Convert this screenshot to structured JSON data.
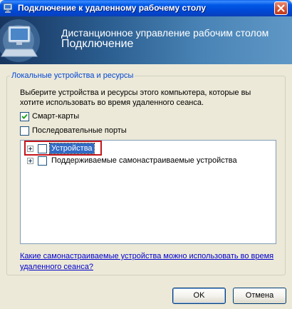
{
  "window": {
    "title": "Подключение к удаленному рабочему столу",
    "title_icon": "remote-desktop-icon",
    "close_icon": "close-icon"
  },
  "banner": {
    "line1": "Дистанционное управление рабочим столом",
    "line2": "Подключение",
    "icon": "remote-desktop-computer-icon"
  },
  "group": {
    "legend": "Локальные устройства и ресурсы",
    "description": "Выберите устройства и ресурсы этого компьютера, которые вы хотите использовать во время удаленного сеанса.",
    "checkboxes": [
      {
        "label": "Смарт-карты",
        "checked": true
      },
      {
        "label": "Последовательные порты",
        "checked": false
      }
    ],
    "tree": [
      {
        "label": "Устройства",
        "checked": false,
        "selected": true,
        "expandable": true
      },
      {
        "label": "Поддерживаемые самонастраиваемые устройства",
        "checked": false,
        "selected": false,
        "expandable": true
      }
    ],
    "help_link": "Какие самонастраиваемые устройства можно использовать во время удаленного сеанса?"
  },
  "buttons": {
    "ok": "OK",
    "cancel": "Отмена"
  },
  "colors": {
    "title_bar": "#0054E3",
    "dialog_bg": "#ECE9D8",
    "legend_text": "#0046D5",
    "selection": "#316AC5",
    "highlight_box": "#C4161C",
    "link": "#0000CC"
  }
}
